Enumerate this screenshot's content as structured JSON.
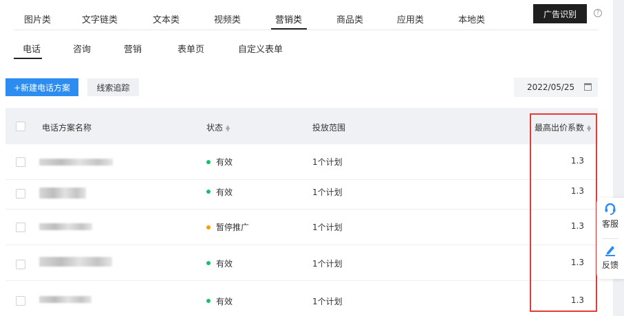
{
  "category_tabs": [
    "图片类",
    "文字链类",
    "文本类",
    "视频类",
    "营销类",
    "商品类",
    "应用类",
    "本地类"
  ],
  "active_category": "营销类",
  "ad_recognition_button": "广告识别",
  "help_symbol": "?",
  "sub_tabs": [
    "电话",
    "咨询",
    "营销",
    "表单页",
    "自定义表单"
  ],
  "active_sub_tab": "电话",
  "toolbar": {
    "new_plan_label": "+新建电话方案",
    "track_label": "线索追踪",
    "date_value": "2022/05/25"
  },
  "table": {
    "headers": {
      "name": "电话方案名称",
      "status": "状态",
      "scope": "投放范围",
      "max_bid": "最高出价系数"
    },
    "rows": [
      {
        "status": "有效",
        "status_color": "#19be6b",
        "scope": "1个计划",
        "max_bid": "1.3"
      },
      {
        "status": "有效",
        "status_color": "#19be6b",
        "scope": "1个计划",
        "max_bid": "1.3"
      },
      {
        "status": "暂停推广",
        "status_color": "#ff9900",
        "scope": "1个计划",
        "max_bid": "1.3"
      },
      {
        "status": "有效",
        "status_color": "#19be6b",
        "scope": "1个计划",
        "max_bid": "1.3"
      },
      {
        "status": "有效",
        "status_color": "#19be6b",
        "scope": "1个计划",
        "max_bid": "1.3"
      }
    ]
  },
  "float_panel": {
    "service_label": "客服",
    "feedback_label": "反馈"
  },
  "colors": {
    "primary": "#2d8cf0",
    "highlight_box": "#e53935",
    "status_active": "#19be6b",
    "status_paused": "#ff9900"
  }
}
